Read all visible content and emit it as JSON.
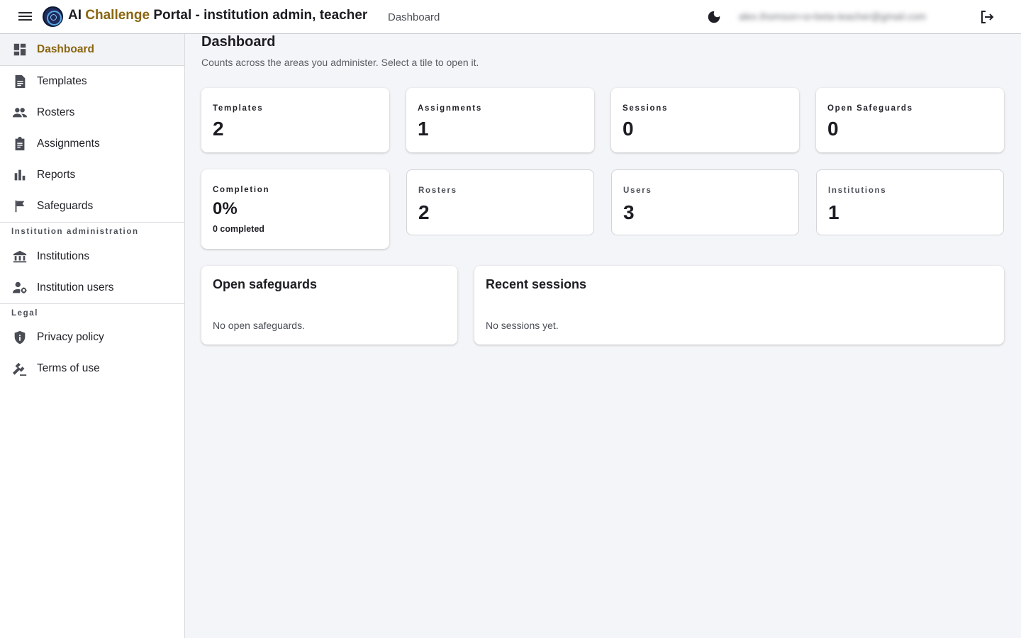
{
  "header": {
    "title_prefix": "AI ",
    "title_accent": "Challenge",
    "title_suffix": " Portal - institution admin, teacher",
    "breadcrumb": "Dashboard",
    "user_email": "alex.thomson+a+beta-teacher@gmail.com",
    "theme_icon": "moon-icon",
    "logout_icon": "logout-icon"
  },
  "sidebar": {
    "items": [
      {
        "label": "Dashboard",
        "icon": "dashboard-icon"
      },
      {
        "label": "Templates",
        "icon": "document-icon"
      },
      {
        "label": "Rosters",
        "icon": "people-icon"
      },
      {
        "label": "Assignments",
        "icon": "clipboard-icon"
      },
      {
        "label": "Reports",
        "icon": "bar-chart-icon"
      },
      {
        "label": "Safeguards",
        "icon": "flag-icon"
      }
    ],
    "section_admin": "Institution administration",
    "admin_items": [
      {
        "label": "Institutions",
        "icon": "bank-icon"
      },
      {
        "label": "Institution users",
        "icon": "user-gear-icon"
      }
    ],
    "section_legal": "Legal",
    "legal_items": [
      {
        "label": "Privacy policy",
        "icon": "shield-icon"
      },
      {
        "label": "Terms of use",
        "icon": "gavel-icon"
      }
    ]
  },
  "main": {
    "title": "Dashboard",
    "subtitle": "Counts across the areas you administer. Select a tile to open it.",
    "tiles": [
      {
        "label": "Templates",
        "value": "2"
      },
      {
        "label": "Assignments",
        "value": "1"
      },
      {
        "label": "Sessions",
        "value": "0"
      },
      {
        "label": "Open Safeguards",
        "value": "0"
      },
      {
        "label": "Completion",
        "value": "0%",
        "extra": "0 completed"
      },
      {
        "label": "Rosters",
        "value": "2"
      },
      {
        "label": "Users",
        "value": "3"
      },
      {
        "label": "Institutions",
        "value": "1"
      }
    ],
    "panels": {
      "safeguards": {
        "title": "Open safeguards",
        "empty": "No open safeguards."
      },
      "sessions": {
        "title": "Recent sessions",
        "empty": "No sessions yet."
      }
    }
  },
  "colors": {
    "accent": "#8a6510",
    "icon": "#4a4d55"
  }
}
